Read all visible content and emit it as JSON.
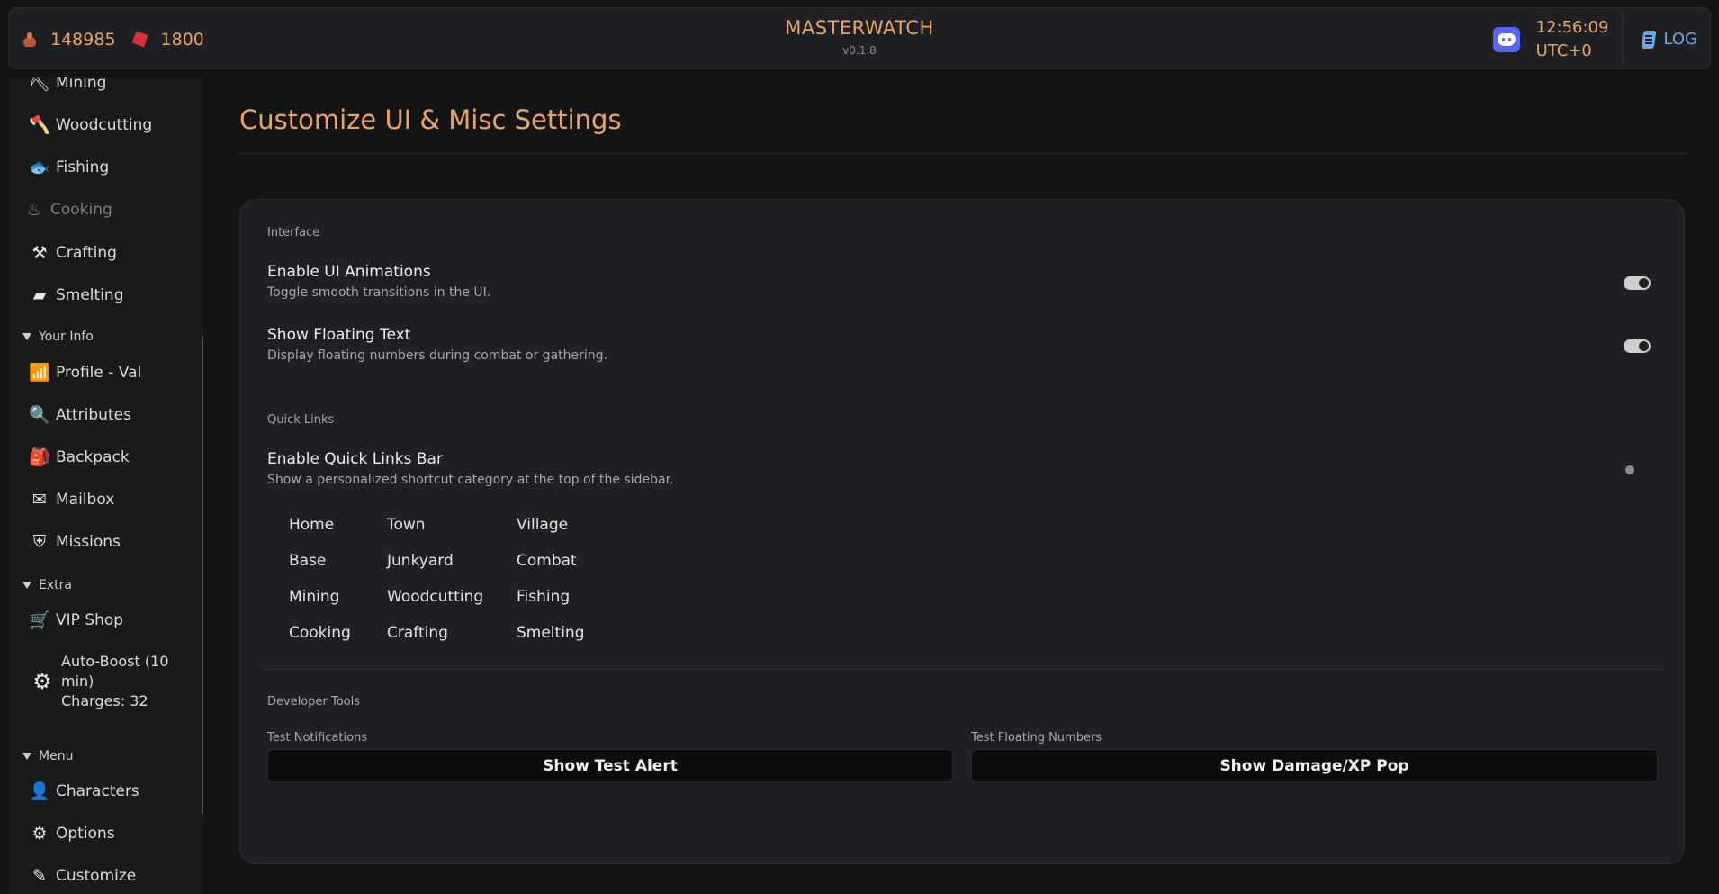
{
  "topbar": {
    "coins": "148985",
    "gems": "1800",
    "title": "MASTERWATCH",
    "version": "v0.1.8",
    "time": "12:56:09",
    "timezone": "UTC+0",
    "log_label": "LOG"
  },
  "sidebar": {
    "skills": [
      {
        "label": "Mining",
        "icon": "mining-icon"
      },
      {
        "label": "Woodcutting",
        "icon": "woodcutting-icon"
      },
      {
        "label": "Fishing",
        "icon": "fishing-icon"
      },
      {
        "label": "Cooking",
        "icon": "cooking-icon"
      },
      {
        "label": "Crafting",
        "icon": "crafting-icon"
      },
      {
        "label": "Smelting",
        "icon": "smelting-icon"
      }
    ],
    "your_info": {
      "title": "Your Info",
      "items": [
        {
          "label": "Profile - Val",
          "icon": "profile-icon"
        },
        {
          "label": "Attributes",
          "icon": "attributes-icon"
        },
        {
          "label": "Backpack",
          "icon": "backpack-icon"
        },
        {
          "label": "Mailbox",
          "icon": "mailbox-icon"
        },
        {
          "label": "Missions",
          "icon": "missions-icon"
        }
      ]
    },
    "extra": {
      "title": "Extra",
      "items": [
        {
          "label": "VIP Shop",
          "icon": "cart-icon"
        }
      ],
      "autoboost": {
        "label": "Auto-Boost (10 min)",
        "charges": "Charges: 32",
        "icon": "autoboost-icon"
      }
    },
    "menu": {
      "title": "Menu",
      "items": [
        {
          "label": "Characters",
          "icon": "character-icon"
        },
        {
          "label": "Options",
          "icon": "gear-icon"
        },
        {
          "label": "Customize",
          "icon": "customize-icon"
        }
      ]
    }
  },
  "main": {
    "title": "Customize UI & Misc Settings",
    "interface": {
      "label": "Interface",
      "settings": [
        {
          "title": "Enable UI Animations",
          "desc": "Toggle smooth transitions in the UI.",
          "enabled": true
        },
        {
          "title": "Show Floating Text",
          "desc": "Display floating numbers during combat or gathering.",
          "enabled": true
        }
      ]
    },
    "quick_links": {
      "label": "Quick Links",
      "title": "Enable Quick Links Bar",
      "desc": "Show a personalized shortcut category at the top of the sidebar.",
      "enabled": false,
      "links": [
        [
          "Home",
          "Town",
          "Village"
        ],
        [
          "Base",
          "Junkyard",
          "Combat"
        ],
        [
          "Mining",
          "Woodcutting",
          "Fishing"
        ],
        [
          "Cooking",
          "Crafting",
          "Smelting"
        ]
      ]
    },
    "dev_tools": {
      "label": "Developer Tools",
      "test_notifications_label": "Test Notifications",
      "test_alert_button": "Show Test Alert",
      "test_floating_label": "Test Floating Numbers",
      "test_floating_button": "Show Damage/XP Pop"
    }
  }
}
